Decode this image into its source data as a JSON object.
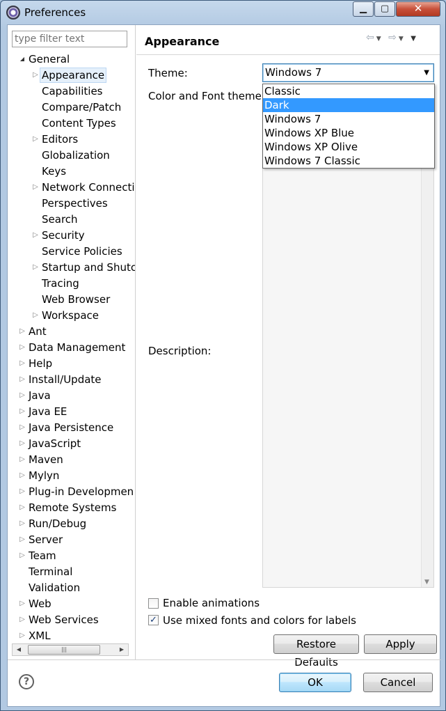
{
  "window": {
    "title": "Preferences"
  },
  "filter": {
    "placeholder": "type filter text"
  },
  "tree": [
    {
      "label": "General",
      "expanded": true,
      "level": 0
    },
    {
      "label": "Appearance",
      "level": 1,
      "arrow": true,
      "selected": true
    },
    {
      "label": "Capabilities",
      "level": 1
    },
    {
      "label": "Compare/Patch",
      "level": 1
    },
    {
      "label": "Content Types",
      "level": 1
    },
    {
      "label": "Editors",
      "level": 1,
      "arrow": true
    },
    {
      "label": "Globalization",
      "level": 1
    },
    {
      "label": "Keys",
      "level": 1
    },
    {
      "label": "Network Connecti",
      "level": 1,
      "arrow": true
    },
    {
      "label": "Perspectives",
      "level": 1
    },
    {
      "label": "Search",
      "level": 1
    },
    {
      "label": "Security",
      "level": 1,
      "arrow": true
    },
    {
      "label": "Service Policies",
      "level": 1
    },
    {
      "label": "Startup and Shutc",
      "level": 1,
      "arrow": true
    },
    {
      "label": "Tracing",
      "level": 1
    },
    {
      "label": "Web Browser",
      "level": 1
    },
    {
      "label": "Workspace",
      "level": 1,
      "arrow": true
    },
    {
      "label": "Ant",
      "level": 0,
      "arrow": true
    },
    {
      "label": "Data Management",
      "level": 0,
      "arrow": true
    },
    {
      "label": "Help",
      "level": 0,
      "arrow": true
    },
    {
      "label": "Install/Update",
      "level": 0,
      "arrow": true
    },
    {
      "label": "Java",
      "level": 0,
      "arrow": true
    },
    {
      "label": "Java EE",
      "level": 0,
      "arrow": true
    },
    {
      "label": "Java Persistence",
      "level": 0,
      "arrow": true
    },
    {
      "label": "JavaScript",
      "level": 0,
      "arrow": true
    },
    {
      "label": "Maven",
      "level": 0,
      "arrow": true
    },
    {
      "label": "Mylyn",
      "level": 0,
      "arrow": true
    },
    {
      "label": "Plug-in Developmen",
      "level": 0,
      "arrow": true
    },
    {
      "label": "Remote Systems",
      "level": 0,
      "arrow": true
    },
    {
      "label": "Run/Debug",
      "level": 0,
      "arrow": true
    },
    {
      "label": "Server",
      "level": 0,
      "arrow": true
    },
    {
      "label": "Team",
      "level": 0,
      "arrow": true
    },
    {
      "label": "Terminal",
      "level": 0
    },
    {
      "label": "Validation",
      "level": 0
    },
    {
      "label": "Web",
      "level": 0,
      "arrow": true
    },
    {
      "label": "Web Services",
      "level": 0,
      "arrow": true
    },
    {
      "label": "XML",
      "level": 0,
      "arrow": true
    }
  ],
  "page": {
    "title": "Appearance",
    "theme_label": "Theme:",
    "theme_value": "Windows 7",
    "theme_options": [
      "Classic",
      "Dark",
      "Windows 7",
      "Windows XP Blue",
      "Windows XP Olive",
      "Windows 7 Classic"
    ],
    "highlighted_option": "Dark",
    "color_font_label": "Color and Font theme:",
    "description_label": "Description:",
    "enable_animations": {
      "label": "Enable animations",
      "checked": false
    },
    "mixed_fonts": {
      "label": "Use mixed fonts and colors for labels",
      "checked": true
    },
    "restore_defaults": "Restore Defaults",
    "apply": "Apply"
  },
  "footer": {
    "ok": "OK",
    "cancel": "Cancel",
    "help": "?"
  }
}
